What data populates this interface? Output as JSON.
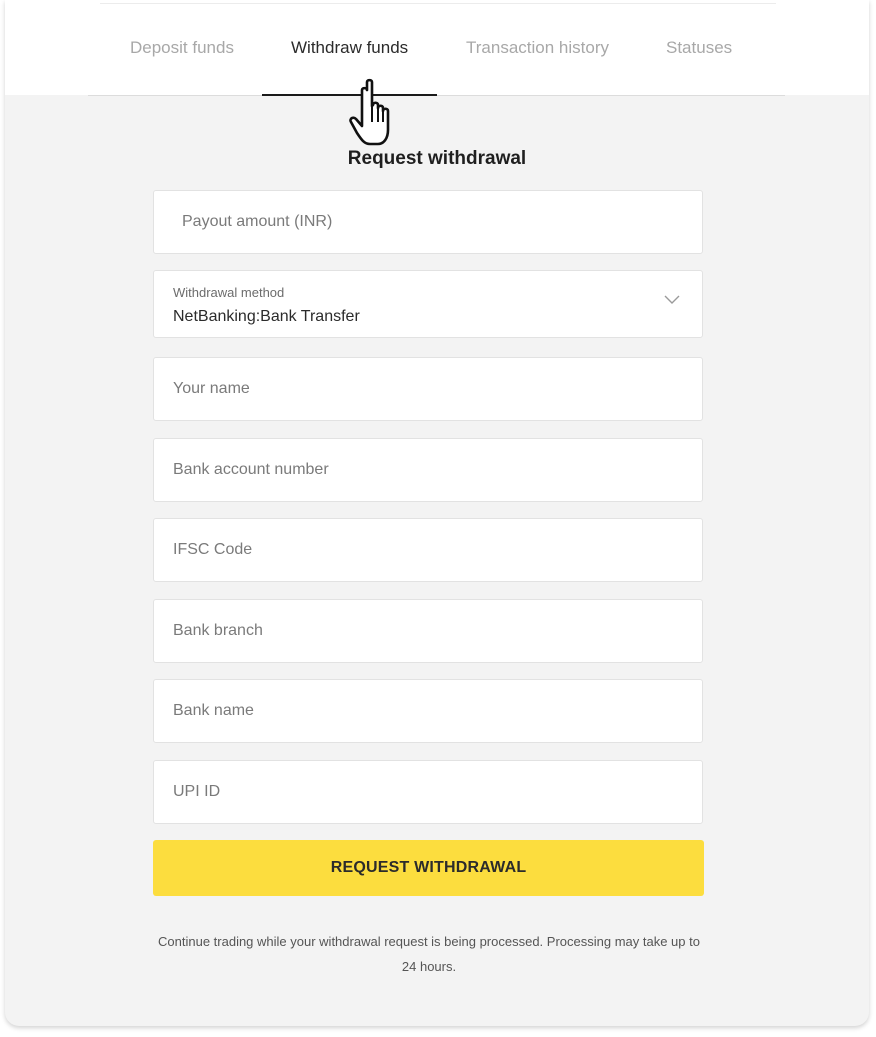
{
  "tabs": {
    "deposit": "Deposit funds",
    "withdraw": "Withdraw funds",
    "history": "Transaction history",
    "statuses": "Statuses"
  },
  "form": {
    "title": "Request withdrawal",
    "payout_amount_placeholder": "Payout amount (INR)",
    "withdrawal_method_label": "Withdrawal method",
    "withdrawal_method_value": "NetBanking:Bank Transfer",
    "name_placeholder": "Your name",
    "account_number_placeholder": "Bank account number",
    "ifsc_placeholder": "IFSC Code",
    "branch_placeholder": "Bank branch",
    "bank_name_placeholder": "Bank name",
    "upi_placeholder": "UPI ID",
    "submit_label": "REQUEST WITHDRAWAL",
    "note": "Continue trading while your withdrawal request is being processed.  Processing may take up to 24 hours."
  },
  "colors": {
    "accent_button": "#fcdd3e",
    "page_background": "#f3f3f3",
    "active_tab_text": "#2b2b2b",
    "inactive_tab_text": "#a8a8a8"
  },
  "icons": {
    "cursor": "hand-pointer-icon",
    "dropdown": "chevron-down-icon"
  }
}
